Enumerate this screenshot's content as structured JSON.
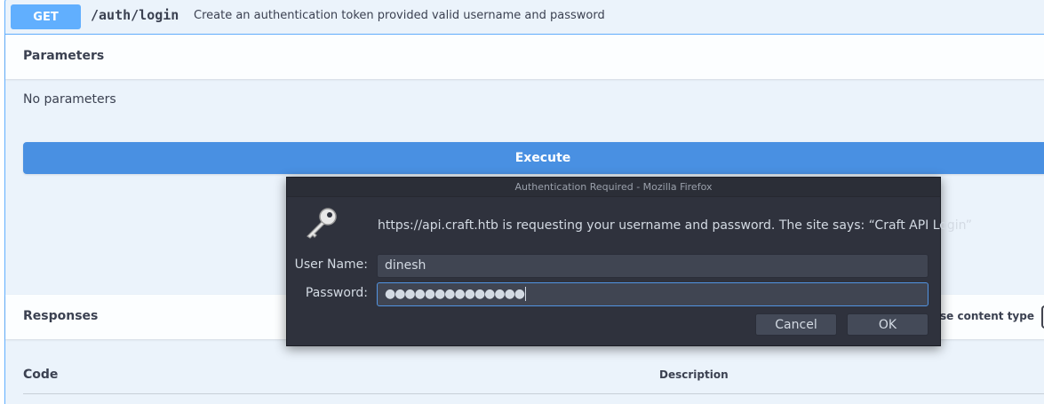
{
  "operation": {
    "method": "GET",
    "path": "/auth/login",
    "description": "Create an authentication token provided valid username and password"
  },
  "parameters": {
    "title": "Parameters",
    "empty_text": "No parameters"
  },
  "execute_label": "Execute",
  "responses": {
    "title": "Responses",
    "content_type_label": "se content type",
    "columns": [
      "Code",
      "Description"
    ]
  },
  "dialog": {
    "title": "Authentication Required - Mozilla Firefox",
    "icon": "key-icon",
    "message": "https://api.craft.htb is requesting your username and password. The site says: “Craft API Login”",
    "username_label": "User Name:",
    "username_value": "dinesh",
    "password_label": "Password:",
    "password_masked": "●●●●●●●●●●●●●●",
    "cancel_label": "Cancel",
    "ok_label": "OK"
  },
  "colors": {
    "get_accent": "#61affe",
    "execute": "#4990e2",
    "dialog_bg": "#2f323d",
    "focus": "#5294e2"
  }
}
